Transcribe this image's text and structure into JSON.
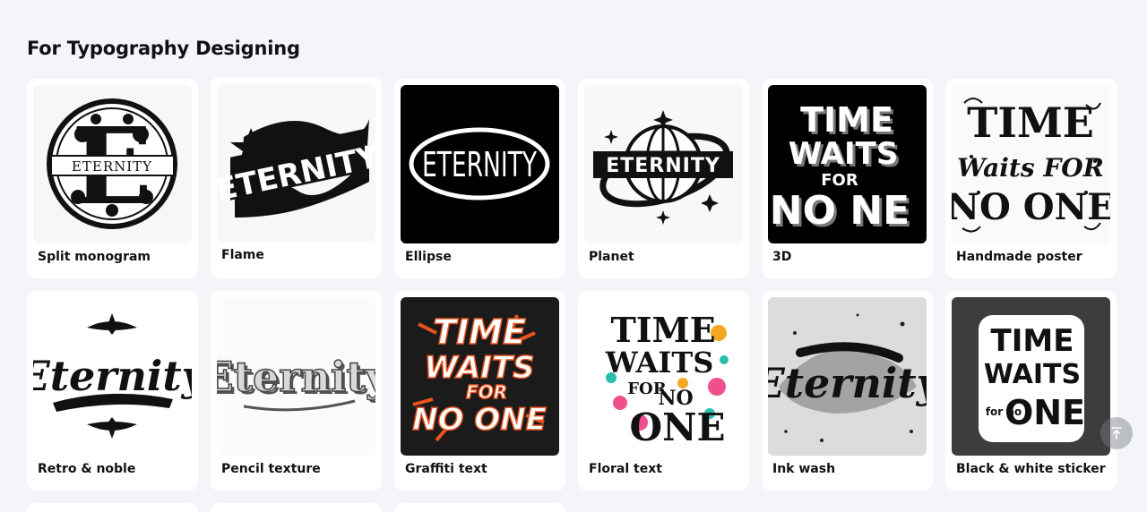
{
  "section": {
    "title": "For Typography Designing"
  },
  "styles": [
    {
      "label": "Split monogram",
      "thumb_text": "ETERNITY",
      "thumb_letter": "E",
      "icon": "split-monogram-thumbnail"
    },
    {
      "label": "Flame",
      "thumb_text": "ETERNITY",
      "icon": "flame-thumbnail"
    },
    {
      "label": "Ellipse",
      "thumb_text": "ETERNITY",
      "icon": "ellipse-thumbnail"
    },
    {
      "label": "Planet",
      "thumb_text": "ETERNITY",
      "icon": "planet-thumbnail"
    },
    {
      "label": "3D",
      "thumb_lines": [
        "TIME",
        "WAITS",
        "FOR",
        "NO NE"
      ],
      "icon": "3d-thumbnail"
    },
    {
      "label": "Handmade poster",
      "thumb_lines": [
        "TIME",
        "Waits FOR",
        "NO ONE"
      ],
      "icon": "handmade-poster-thumbnail"
    },
    {
      "label": "Retro & noble",
      "thumb_text": "Eternity",
      "icon": "retro-noble-thumbnail"
    },
    {
      "label": "Pencil texture",
      "thumb_text": "Eternity",
      "icon": "pencil-texture-thumbnail"
    },
    {
      "label": "Graffiti text",
      "thumb_lines": [
        "TIME",
        "WAITS",
        "FOR",
        "NO ONE"
      ],
      "icon": "graffiti-thumbnail"
    },
    {
      "label": "Floral text",
      "thumb_lines": [
        "TIME",
        "WAITS",
        "FOR",
        "NO",
        "ONE"
      ],
      "icon": "floral-thumbnail"
    },
    {
      "label": "Ink wash",
      "thumb_text": "Eternity",
      "icon": "ink-wash-thumbnail"
    },
    {
      "label": "Black & white sticker",
      "thumb_lines": [
        "TIME",
        "WAITS",
        "for no",
        "ONE"
      ],
      "icon": "sticker-thumbnail"
    }
  ],
  "scroll_top": {
    "icon": "arrow-up-to-top-icon"
  },
  "colors": {
    "background": "#f3f5f9",
    "card": "#ffffff",
    "graffiti_accent": "#e8531f",
    "floral_pink": "#ef4f8c",
    "floral_orange": "#f5a623",
    "floral_teal": "#2bbfae"
  }
}
